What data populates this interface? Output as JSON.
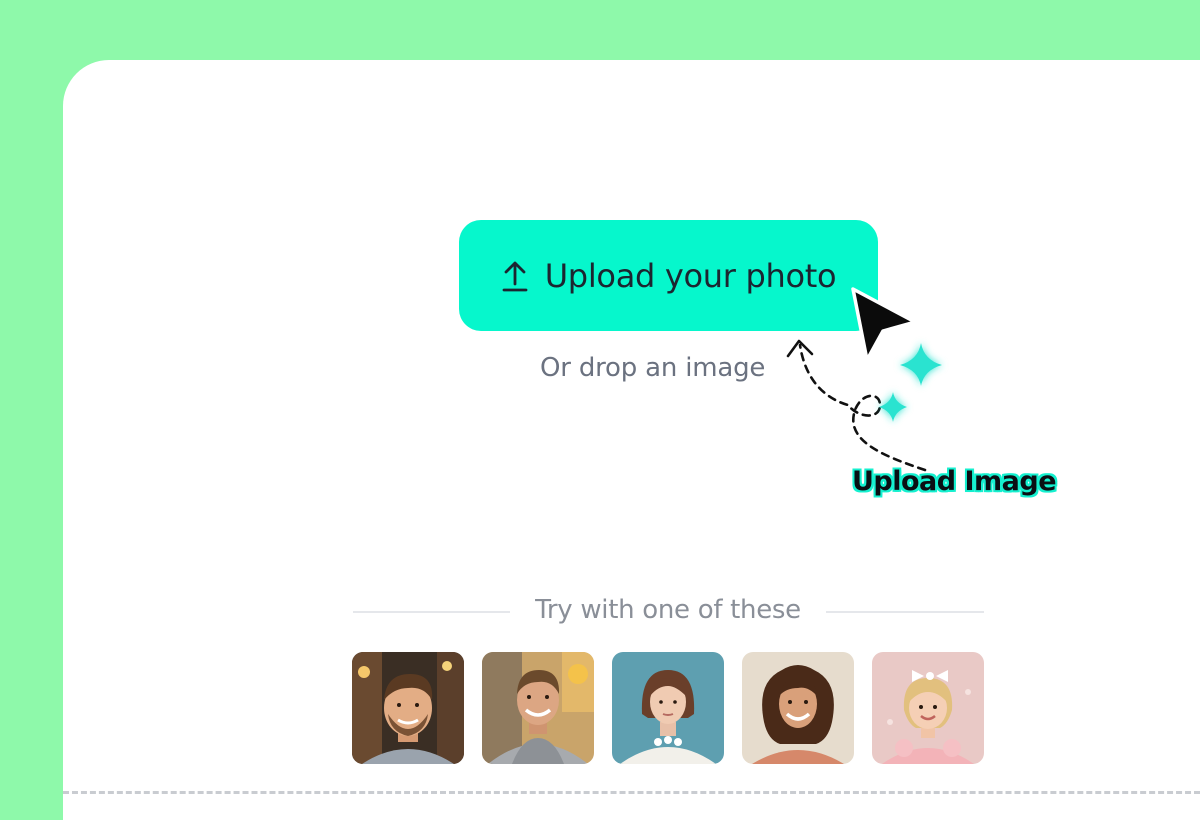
{
  "upload": {
    "button_label": "Upload your photo",
    "button_icon": "upload-arrow-icon",
    "drop_hint": "Or drop an image"
  },
  "annotation": {
    "label": "Upload Image"
  },
  "samples": {
    "heading": "Try with one of these",
    "items": [
      {
        "name": "sample-photo-1",
        "subject": "smiling young man with beard, street background"
      },
      {
        "name": "sample-photo-2",
        "subject": "smiling young man in grey hoodie, outdoor background"
      },
      {
        "name": "sample-photo-3",
        "subject": "young woman with bob haircut, teal background"
      },
      {
        "name": "sample-photo-4",
        "subject": "smiling woman with curly hair, beige background"
      },
      {
        "name": "sample-photo-5",
        "subject": "little girl with bow, pink background"
      }
    ]
  },
  "colors": {
    "page_background": "#8ef9aa",
    "panel_background": "#ffffff",
    "button_accent": "#06f7cc",
    "annotation_accent": "#15f0cf"
  }
}
